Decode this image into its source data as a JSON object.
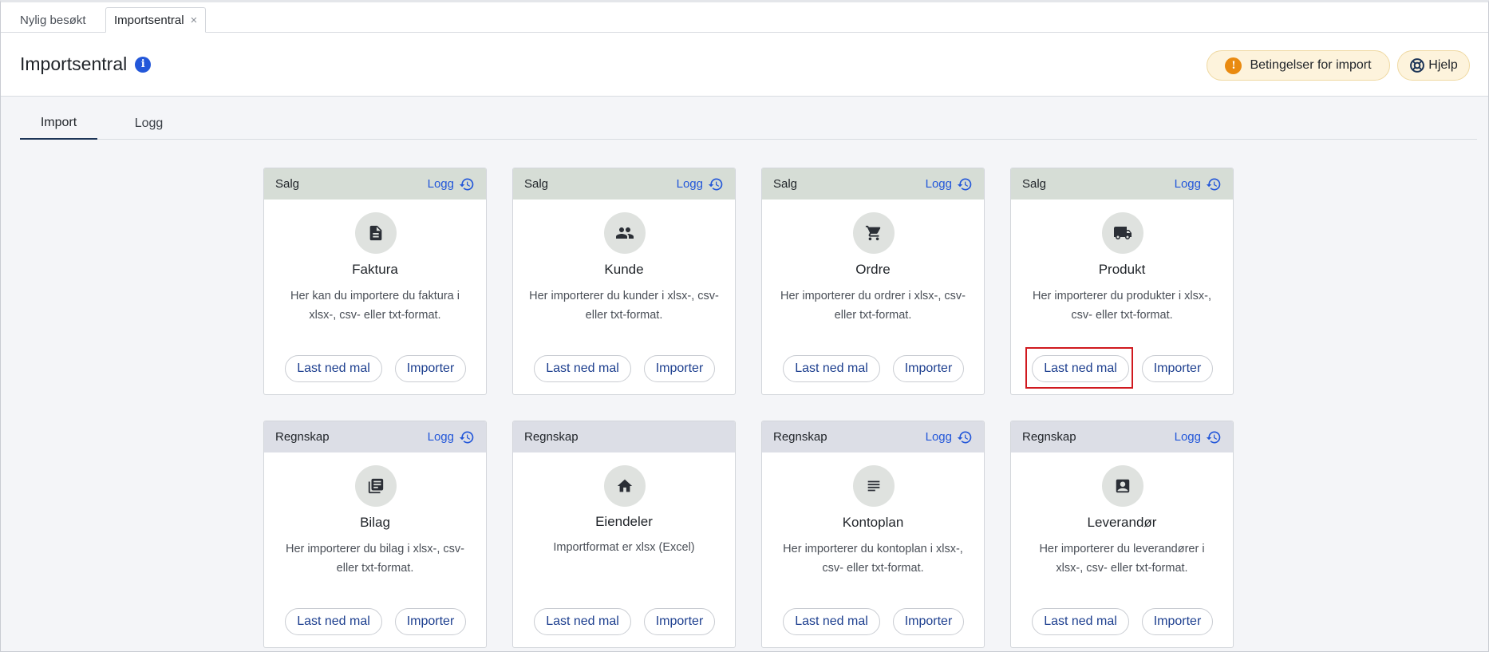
{
  "tabs": {
    "recent": "Nylig besøkt",
    "active": "Importsentral",
    "close": "×"
  },
  "header": {
    "title": "Importsentral",
    "info": "i",
    "conditions_label": "Betingelser for import",
    "conditions_icon_text": "!",
    "help_label": "Hjelp"
  },
  "section_tabs": {
    "import": "Import",
    "logg": "Logg"
  },
  "cards": [
    {
      "category": "Salg",
      "logg": "Logg",
      "icon": "invoice-icon",
      "title": "Faktura",
      "desc": "Her kan du importere du faktura i xlsx-, csv- eller txt-format.",
      "download": "Last ned mal",
      "import": "Importer"
    },
    {
      "category": "Salg",
      "logg": "Logg",
      "icon": "people-icon",
      "title": "Kunde",
      "desc": "Her importerer du kunder i xlsx-, csv- eller txt-format.",
      "download": "Last ned mal",
      "import": "Importer"
    },
    {
      "category": "Salg",
      "logg": "Logg",
      "icon": "cart-icon",
      "title": "Ordre",
      "desc": "Her importerer du ordrer i xlsx-, csv- eller txt-format.",
      "download": "Last ned mal",
      "import": "Importer"
    },
    {
      "category": "Salg",
      "logg": "Logg",
      "icon": "truck-icon",
      "title": "Produkt",
      "desc": "Her importerer du produkter i xlsx-, csv- eller txt-format.",
      "download": "Last ned mal",
      "import": "Importer"
    },
    {
      "category": "Regnskap",
      "logg": "Logg",
      "icon": "ledger-icon",
      "title": "Bilag",
      "desc": "Her importerer du bilag i xlsx-, csv- eller txt-format.",
      "download": "Last ned mal",
      "import": "Importer"
    },
    {
      "category": "Regnskap",
      "logg": "",
      "icon": "home-icon",
      "title": "Eiendeler",
      "desc": "Importformat er xlsx (Excel)",
      "download": "Last ned mal",
      "import": "Importer"
    },
    {
      "category": "Regnskap",
      "logg": "Logg",
      "icon": "lines-icon",
      "title": "Kontoplan",
      "desc": "Her importerer du kontoplan i xlsx-, csv- eller txt-format.",
      "download": "Last ned mal",
      "import": "Importer"
    },
    {
      "category": "Regnskap",
      "logg": "Logg",
      "icon": "contact-icon",
      "title": "Leverandør",
      "desc": "Her importerer du leverandører i xlsx-, csv- eller txt-format.",
      "download": "Last ned mal",
      "import": "Importer"
    }
  ],
  "colors": {
    "accent_blue": "#2357d9",
    "button_text": "#1d3f8f",
    "warning_orange": "#e98a10",
    "highlight_red": "#d0191f"
  }
}
